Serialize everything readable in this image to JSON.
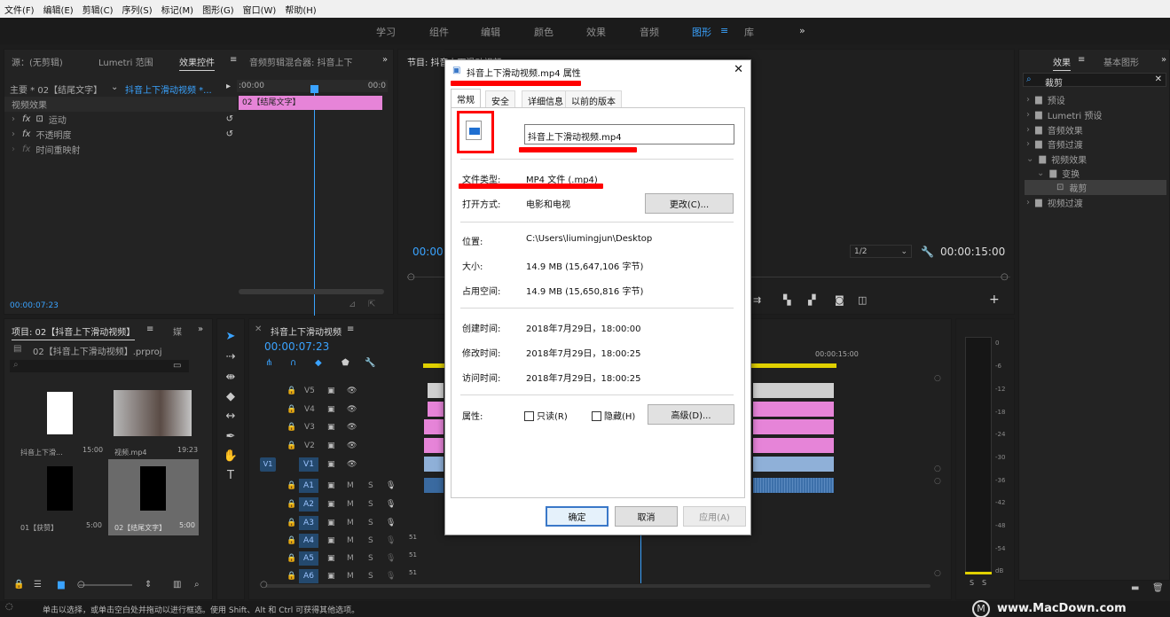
{
  "menu": [
    "文件(F)",
    "编辑(E)",
    "剪辑(C)",
    "序列(S)",
    "标记(M)",
    "图形(G)",
    "窗口(W)",
    "帮助(H)"
  ],
  "workspaces": [
    "学习",
    "组件",
    "编辑",
    "颜色",
    "效果",
    "音频",
    "图形",
    "库"
  ],
  "workspace_active": "图形",
  "source_panel": {
    "tabs": [
      "源：(无剪辑)",
      "Lumetri 范围",
      "效果控件",
      "音频剪辑混合器: 抖音上下"
    ],
    "master_label": "主要 * 02【结尾文字】",
    "clip_label": "抖音上下滑动视频 *...",
    "ruler_start": ":00:00",
    "ruler_end": "00:0",
    "clip_name": "02【结尾文字】",
    "section": "视频效果",
    "effects": [
      "运动",
      "不透明度",
      "时间重映射"
    ],
    "timecode": "00:00:07:23"
  },
  "program_panel": {
    "title": "节目: 抖音上下滑动视频",
    "timecode_left": "00:00",
    "zoom": "1/2",
    "timecode_right": "00:00:15:00"
  },
  "effects_panel": {
    "tabs": [
      "效果",
      "基本图形"
    ],
    "search": "裁剪",
    "tree": [
      "预设",
      "Lumetri 预设",
      "音频效果",
      "音频过渡",
      "视频效果",
      "变换",
      "裁剪",
      "视频过渡"
    ]
  },
  "project_panel": {
    "title": "项目: 02【抖音上下滑动视频】",
    "file": "02【抖音上下滑动视频】.prproj",
    "items": [
      {
        "name": "抖音上下滑...",
        "dur": "15:00"
      },
      {
        "name": "视频.mp4",
        "dur": "19:23"
      },
      {
        "name": "01【获赞】",
        "dur": "5:00"
      },
      {
        "name": "02【结尾文字】",
        "dur": "5:00"
      }
    ]
  },
  "timeline": {
    "title": "抖音上下滑动视频",
    "timecode": "00:00:07:23",
    "ruler_label": "00:00:15:00",
    "video_tracks": [
      "V5",
      "V4",
      "V3",
      "V2",
      "V1"
    ],
    "audio_tracks": [
      "A1",
      "A2",
      "A3",
      "A4",
      "A5",
      "A6"
    ],
    "v1_source": "V1",
    "m": "M",
    "s": "S"
  },
  "meter": {
    "scale": [
      "0",
      "-6",
      "-12",
      "-18",
      "-24",
      "-30",
      "-36",
      "-42",
      "-48",
      "-54",
      "dB"
    ],
    "solo": [
      "S",
      "S"
    ]
  },
  "status": "单击以选择，或单击空白处并拖动以进行框选。使用 Shift、Alt 和 Ctrl 可获得其他选项。",
  "watermark": "www.MacDown.com",
  "dialog": {
    "title": "抖音上下滑动视频.mp4 属性",
    "close": "✕",
    "tabs": [
      "常规",
      "安全",
      "详细信息",
      "以前的版本"
    ],
    "filename": "抖音上下滑动视频.mp4",
    "rows": [
      {
        "label": "文件类型:",
        "value": "MP4 文件 (.mp4)"
      },
      {
        "label": "打开方式:",
        "value": "电影和电视"
      },
      {
        "label": "位置:",
        "value": "C:\\Users\\liumingjun\\Desktop"
      },
      {
        "label": "大小:",
        "value": "14.9 MB (15,647,106 字节)"
      },
      {
        "label": "占用空间:",
        "value": "14.9 MB (15,650,816 字节)"
      },
      {
        "label": "创建时间:",
        "value": "2018年7月29日，18:00:00"
      },
      {
        "label": "修改时间:",
        "value": "2018年7月29日，18:00:25"
      },
      {
        "label": "访问时间:",
        "value": "2018年7月29日，18:00:25"
      }
    ],
    "change_btn": "更改(C)...",
    "attr_label": "属性:",
    "readonly": "只读(R)",
    "hidden": "隐藏(H)",
    "advanced_btn": "高级(D)...",
    "ok": "确定",
    "cancel": "取消",
    "apply": "应用(A)"
  }
}
